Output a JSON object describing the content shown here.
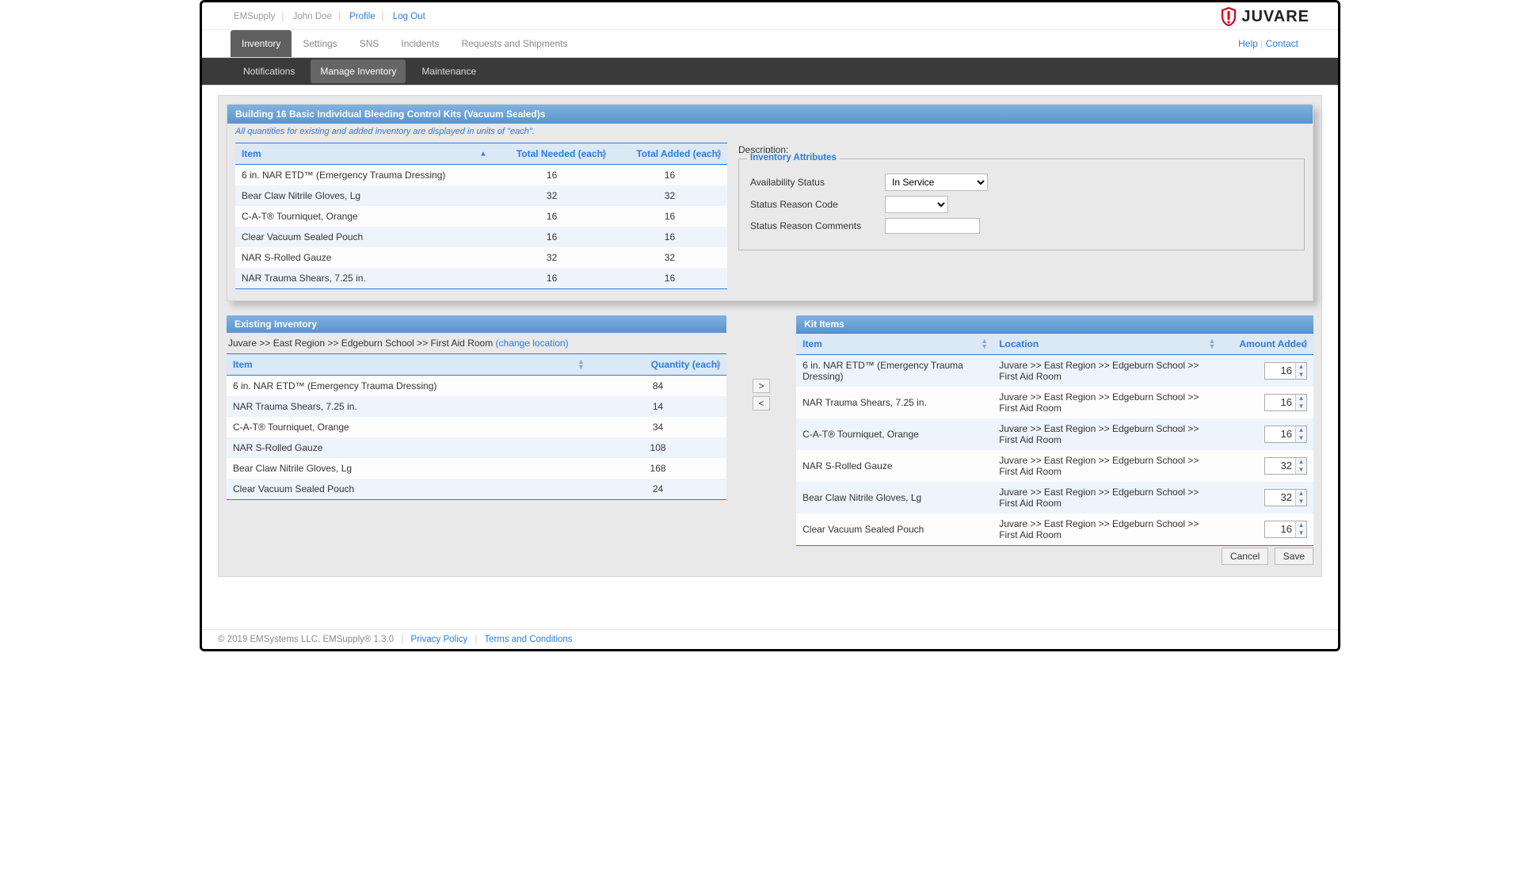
{
  "topbar": {
    "app": "EMSupply",
    "user": "John Doe",
    "profile": "Profile",
    "logout": "Log Out",
    "logo_text": "JUVARE"
  },
  "main_tabs": {
    "inventory": "Inventory",
    "settings": "Settings",
    "sns": "SNS",
    "incidents": "Incidents",
    "requests": "Requests and Shipments",
    "help": "Help",
    "contact": "Contact"
  },
  "sub_tabs": {
    "notifications": "Notifications",
    "manage": "Manage Inventory",
    "maintenance": "Maintenance"
  },
  "kit": {
    "title": "Building 16 Basic Individual Bleeding Control Kits (Vacuum Sealed)s",
    "note": "All quantities for existing and added inventory are displayed in units of \"each\".",
    "headers": {
      "item": "Item",
      "needed": "Total Needed (each)",
      "added": "Total Added (each)"
    },
    "rows": [
      {
        "item": "6 in. NAR ETD™ (Emergency Trauma Dressing)",
        "needed": "16",
        "added": "16"
      },
      {
        "item": "Bear Claw Nitrile Gloves, Lg",
        "needed": "32",
        "added": "32"
      },
      {
        "item": "C-A-T® Tourniquet, Orange",
        "needed": "16",
        "added": "16"
      },
      {
        "item": "Clear Vacuum Sealed Pouch",
        "needed": "16",
        "added": "16"
      },
      {
        "item": "NAR S-Rolled Gauze",
        "needed": "32",
        "added": "32"
      },
      {
        "item": "NAR Trauma Shears, 7.25 in.",
        "needed": "16",
        "added": "16"
      }
    ]
  },
  "description_label": "Description:",
  "attrs": {
    "legend": "Inventory Attributes",
    "availability_label": "Availability Status",
    "availability_value": "In Service",
    "reason_code_label": "Status Reason Code",
    "reason_code_value": "",
    "comments_label": "Status Reason Comments",
    "comments_value": ""
  },
  "existing": {
    "title": "Existing Inventory",
    "breadcrumb_text": "Juvare >> East Region >> Edgeburn School >> First Aid Room ",
    "change_link": "(change location)",
    "headers": {
      "item": "Item",
      "qty": "Quantity (each)"
    },
    "rows": [
      {
        "item": "6 in. NAR ETD™ (Emergency Trauma Dressing)",
        "qty": "84"
      },
      {
        "item": "NAR Trauma Shears, 7.25 in.",
        "qty": "14"
      },
      {
        "item": "C-A-T® Tourniquet, Orange",
        "qty": "34"
      },
      {
        "item": "NAR S-Rolled Gauze",
        "qty": "108"
      },
      {
        "item": "Bear Claw Nitrile Gloves, Lg",
        "qty": "168"
      },
      {
        "item": "Clear Vacuum Sealed Pouch",
        "qty": "24"
      }
    ]
  },
  "movers": {
    "add": ">",
    "remove": "<"
  },
  "kit_items": {
    "title": "Kit Items",
    "headers": {
      "item": "Item",
      "location": "Location",
      "amount": "Amount Added"
    },
    "location_text": "Juvare >> East Region >> Edgeburn School >> First Aid Room",
    "rows": [
      {
        "item": "6 in. NAR ETD™ (Emergency Trauma Dressing)",
        "amount": "16"
      },
      {
        "item": "NAR Trauma Shears, 7.25 in.",
        "amount": "16"
      },
      {
        "item": "C-A-T® Tourniquet, Orange",
        "amount": "16"
      },
      {
        "item": "NAR S-Rolled Gauze",
        "amount": "32"
      },
      {
        "item": "Bear Claw Nitrile Gloves, Lg",
        "amount": "32"
      },
      {
        "item": "Clear Vacuum Sealed Pouch",
        "amount": "16"
      }
    ]
  },
  "buttons": {
    "cancel": "Cancel",
    "save": "Save"
  },
  "footer": {
    "copyright": "© 2019 EMSystems LLC. EMSupply® 1.3.0",
    "privacy": "Privacy Policy",
    "terms": "Terms and Conditions"
  }
}
